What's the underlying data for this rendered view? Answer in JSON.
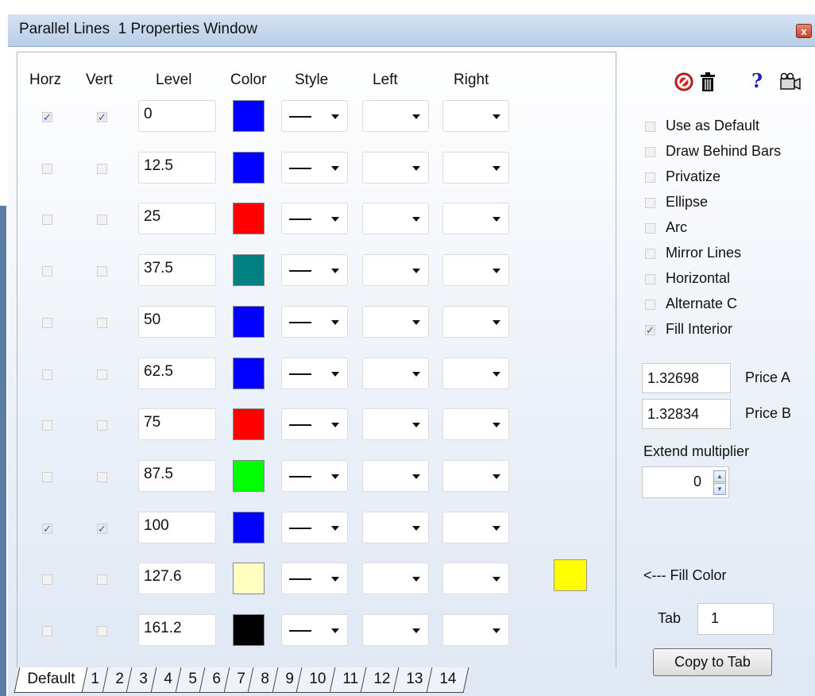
{
  "window": {
    "title": "Parallel Lines  1 Properties Window",
    "close_glyph": "x"
  },
  "headers": {
    "horz": "Horz",
    "vert": "Vert",
    "level": "Level",
    "color": "Color",
    "style": "Style",
    "left": "Left",
    "right": "Right"
  },
  "rows": [
    {
      "horz": true,
      "vert": true,
      "level": "0",
      "color": "#0000ff"
    },
    {
      "horz": false,
      "vert": false,
      "level": "12.5",
      "color": "#0000ff"
    },
    {
      "horz": false,
      "vert": false,
      "level": "25",
      "color": "#ff0000"
    },
    {
      "horz": false,
      "vert": false,
      "level": "37.5",
      "color": "#008080"
    },
    {
      "horz": false,
      "vert": false,
      "level": "50",
      "color": "#0000ff"
    },
    {
      "horz": false,
      "vert": false,
      "level": "62.5",
      "color": "#0000ff"
    },
    {
      "horz": false,
      "vert": false,
      "level": "75",
      "color": "#ff0000"
    },
    {
      "horz": false,
      "vert": false,
      "level": "87.5",
      "color": "#00ff00"
    },
    {
      "horz": true,
      "vert": true,
      "level": "100",
      "color": "#0000ff"
    },
    {
      "horz": false,
      "vert": false,
      "level": "127.6",
      "color": "#ffffc0"
    },
    {
      "horz": false,
      "vert": false,
      "level": "161.2",
      "color": "#000000"
    }
  ],
  "toolbar_icons": [
    "cancel-icon",
    "delete-icon",
    "help-icon",
    "camera-icon"
  ],
  "options": [
    {
      "label": "Use as Default",
      "checked": false
    },
    {
      "label": "Draw Behind Bars",
      "checked": false
    },
    {
      "label": "Privatize",
      "checked": false
    },
    {
      "label": "Ellipse",
      "checked": false
    },
    {
      "label": "Arc",
      "checked": false
    },
    {
      "label": "Mirror Lines",
      "checked": false
    },
    {
      "label": "Horizontal",
      "checked": false
    },
    {
      "label": "Alternate C",
      "checked": false
    },
    {
      "label": "Fill Interior",
      "checked": true
    }
  ],
  "price_a": {
    "value": "1.32698",
    "label": "Price A"
  },
  "price_b": {
    "value": "1.32834",
    "label": "Price B"
  },
  "extend": {
    "label": "Extend multiplier",
    "value": "0"
  },
  "fill": {
    "label": "<--- Fill Color",
    "color": "#ffff00"
  },
  "tab_field": {
    "label": "Tab",
    "value": "1"
  },
  "copy_button": "Copy to Tab",
  "tabs": [
    "Default",
    "1",
    "2",
    "3",
    "4",
    "5",
    "6",
    "7",
    "8",
    "9",
    "10",
    "11",
    "12",
    "13",
    "14"
  ]
}
